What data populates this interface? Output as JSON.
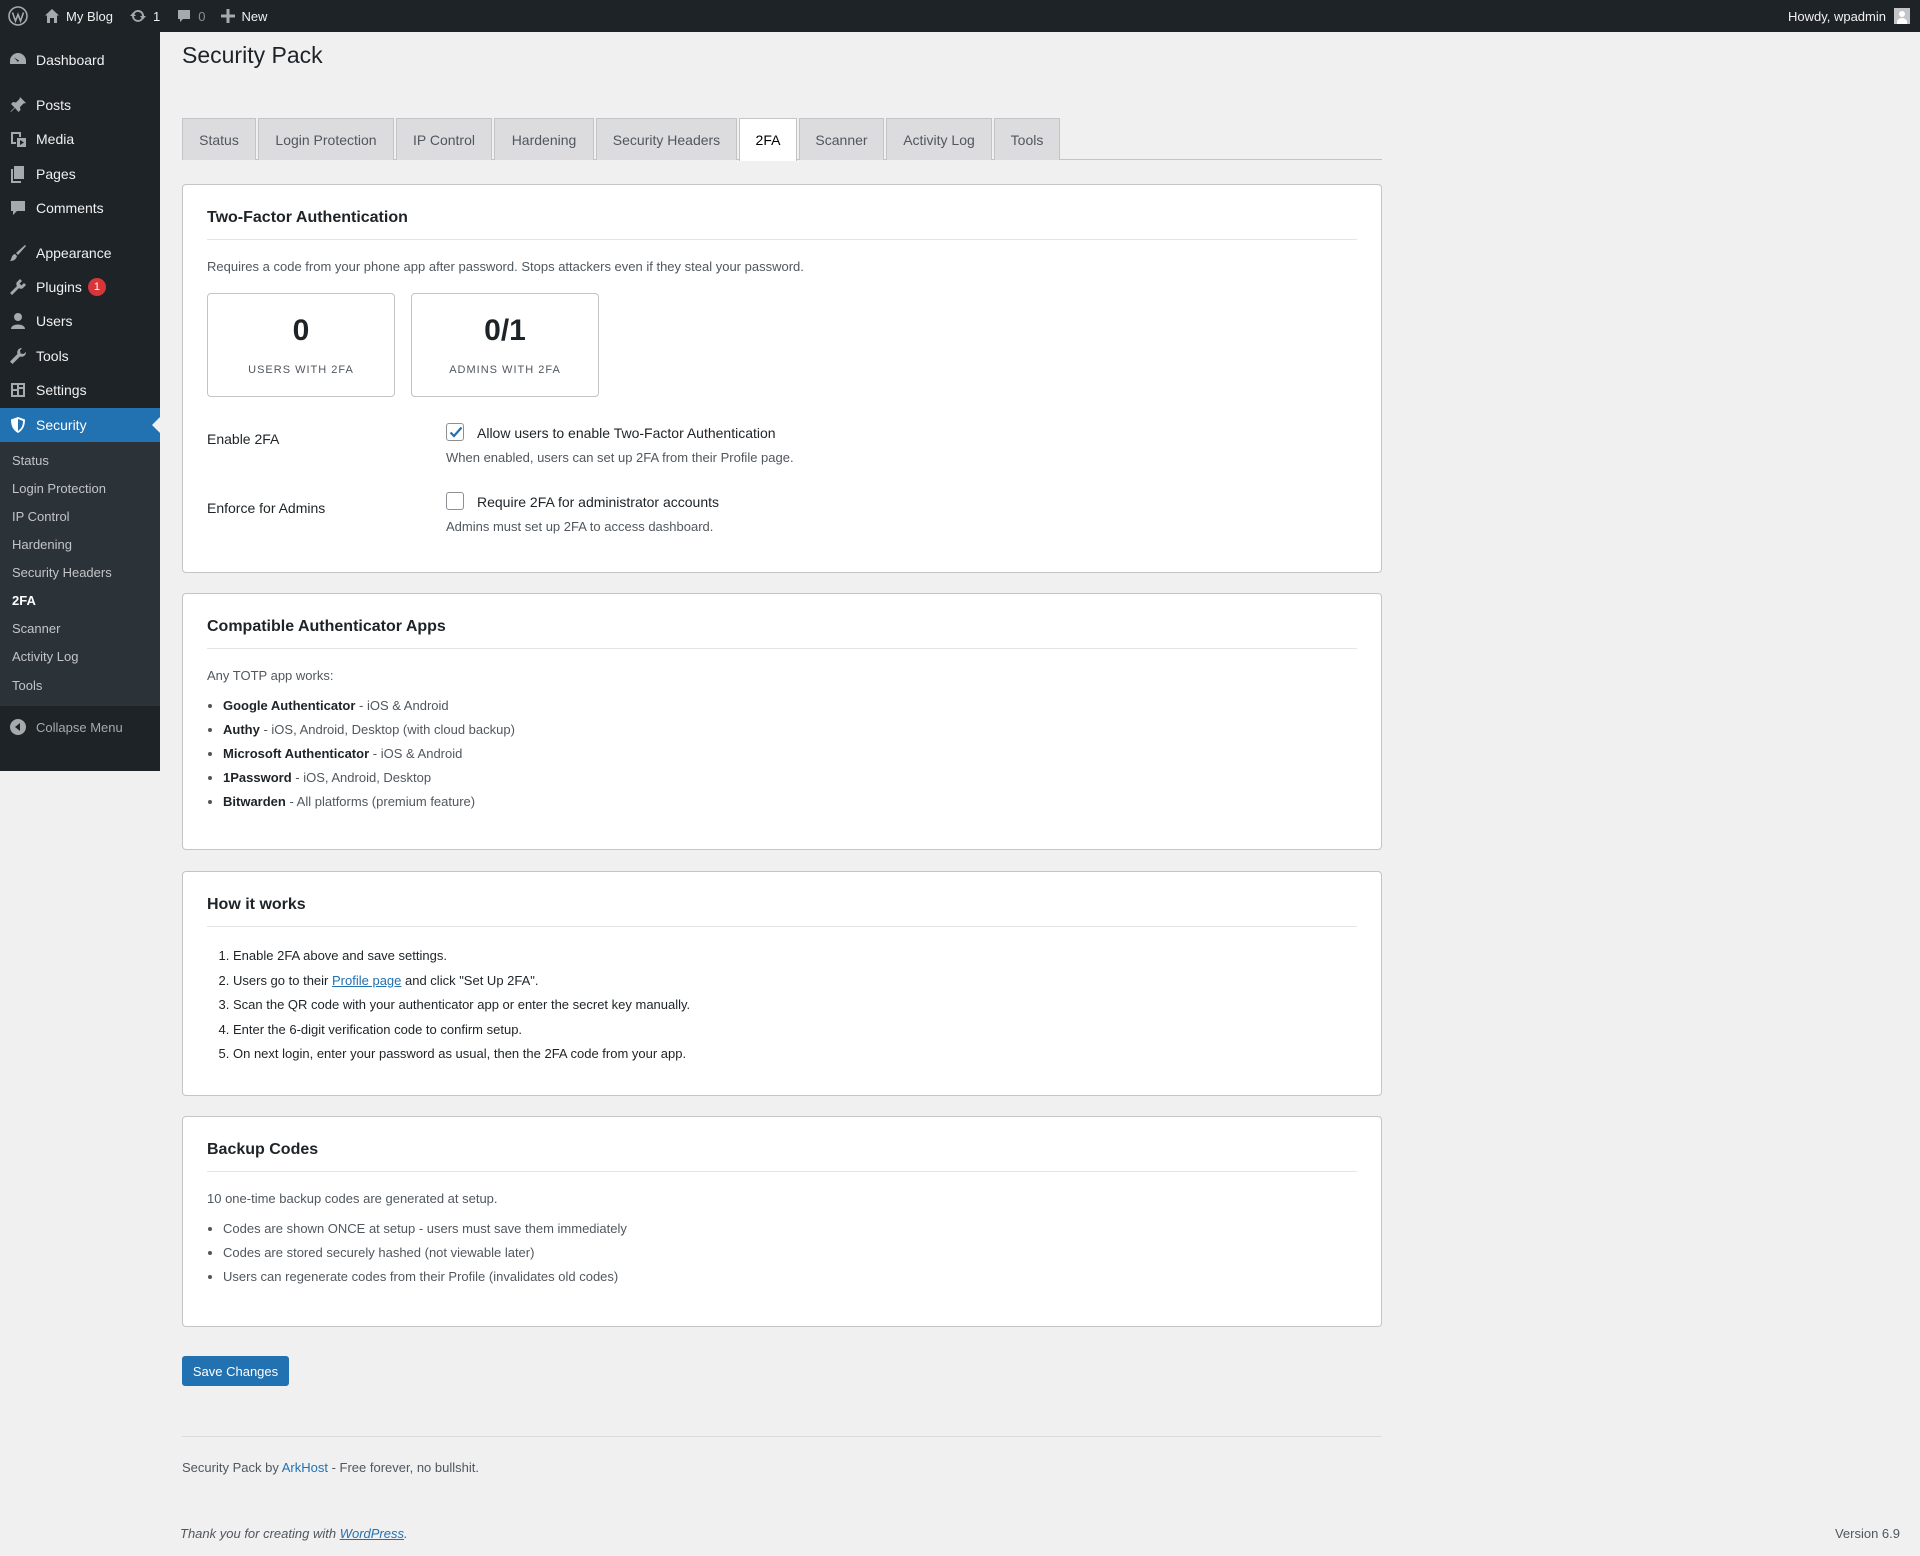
{
  "adminbar": {
    "site_name": "My Blog",
    "updates_count": "1",
    "comments_count": "0",
    "new_label": "New",
    "howdy": "Howdy, wpadmin"
  },
  "sidebar": {
    "dashboard": "Dashboard",
    "posts": "Posts",
    "media": "Media",
    "pages": "Pages",
    "comments": "Comments",
    "appearance": "Appearance",
    "plugins": "Plugins",
    "plugins_badge": "1",
    "users": "Users",
    "tools": "Tools",
    "settings": "Settings",
    "security": "Security",
    "submenu": [
      "Status",
      "Login Protection",
      "IP Control",
      "Hardening",
      "Security Headers",
      "2FA",
      "Scanner",
      "Activity Log",
      "Tools"
    ],
    "collapse": "Collapse Menu"
  },
  "page": {
    "title": "Security Pack",
    "tabs": [
      "Status",
      "Login Protection",
      "IP Control",
      "Hardening",
      "Security Headers",
      "2FA",
      "Scanner",
      "Activity Log",
      "Tools"
    ],
    "active_tab": "2FA"
  },
  "twofa": {
    "title": "Two-Factor Authentication",
    "description": "Requires a code from your phone app after password. Stops attackers even if they steal your password.",
    "stats": [
      {
        "value": "0",
        "label": "USERS WITH 2FA"
      },
      {
        "value": "0/1",
        "label": "ADMINS WITH 2FA"
      }
    ],
    "enable": {
      "label": "Enable 2FA",
      "checkbox_label": "Allow users to enable Two-Factor Authentication",
      "help": "When enabled, users can set up 2FA from their Profile page.",
      "checked": true
    },
    "enforce": {
      "label": "Enforce for Admins",
      "checkbox_label": "Require 2FA for administrator accounts",
      "help": "Admins must set up 2FA to access dashboard.",
      "checked": false
    }
  },
  "apps": {
    "title": "Compatible Authenticator Apps",
    "intro": "Any TOTP app works:",
    "items": [
      {
        "name": "Google Authenticator",
        "detail": " - iOS & Android"
      },
      {
        "name": "Authy",
        "detail": " - iOS, Android, Desktop (with cloud backup)"
      },
      {
        "name": "Microsoft Authenticator",
        "detail": " - iOS & Android"
      },
      {
        "name": "1Password",
        "detail": " - iOS, Android, Desktop"
      },
      {
        "name": "Bitwarden",
        "detail": " - All platforms (premium feature)"
      }
    ]
  },
  "how": {
    "title": "How it works",
    "step1": "Enable 2FA above and save settings.",
    "step2_pre": "Users go to their ",
    "step2_link": "Profile page",
    "step2_post": " and click \"Set Up 2FA\".",
    "step3": "Scan the QR code with your authenticator app or enter the secret key manually.",
    "step4": "Enter the 6-digit verification code to confirm setup.",
    "step5": "On next login, enter your password as usual, then the 2FA code from your app."
  },
  "backup": {
    "title": "Backup Codes",
    "intro": "10 one-time backup codes are generated at setup.",
    "items": [
      "Codes are shown ONCE at setup - users must save them immediately",
      "Codes are stored securely hashed (not viewable later)",
      "Users can regenerate codes from their Profile (invalidates old codes)"
    ]
  },
  "save_button": "Save Changes",
  "footer": {
    "pre": "Security Pack by ",
    "link": "ArkHost",
    "post": " - Free forever, no bullshit.",
    "thanks_pre": "Thank you for creating with ",
    "thanks_link": "WordPress",
    "thanks_post": ".",
    "version": "Version 6.9"
  },
  "colors": {
    "accent": "#2271b1",
    "adminbar": "#1d2327",
    "badge": "#d63638"
  }
}
